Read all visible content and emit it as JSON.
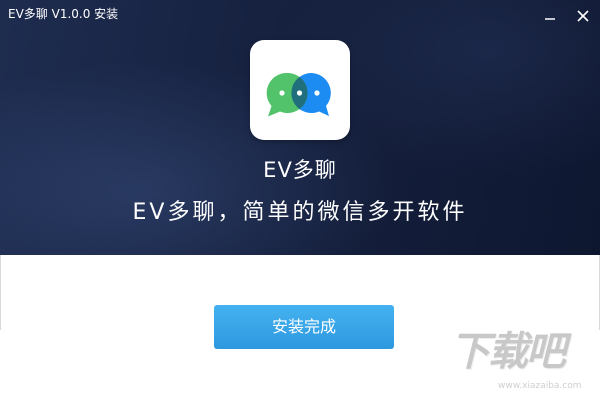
{
  "window": {
    "title": "EV多聊 V1.0.0 安装",
    "minimize_icon": "minimize-icon",
    "close_icon": "close-icon"
  },
  "app": {
    "icon": "chat-bubbles-logo-icon",
    "name": "EV多聊",
    "slogan": "EV多聊，简单的微信多开软件"
  },
  "actions": {
    "finish_label": "安装完成"
  },
  "watermark": {
    "text": "下载吧",
    "sub": "www.xiazaiba.com"
  },
  "colors": {
    "banner_dark": "#16213f",
    "button_blue": "#3aa6ea",
    "logo_green": "#52c36b",
    "logo_blue": "#1d8cf2"
  }
}
